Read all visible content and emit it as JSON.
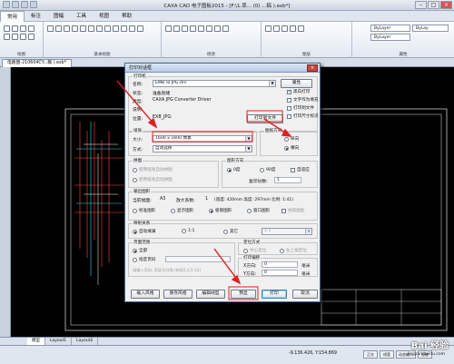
{
  "app": {
    "title": "CAXA CAD 电子图板2015 - [F:\\1.草...                        (0) ...稿 ).exb*]"
  },
  "menu": {
    "tabs": [
      "常用",
      "标注",
      "图幅",
      "工具",
      "视图",
      "帮助"
    ],
    "active": 0
  },
  "ribbon": {
    "groups": [
      "绘图",
      "修改",
      "标注",
      "基本绘图",
      "图层",
      "属性"
    ],
    "by_layer_1": "ByLayer",
    "by_layer_2": "ByLayer",
    "by_layer_3": "ByLay"
  },
  "document_tab": "电路图-210604CY...稿 ).exb*",
  "layout_tabs": [
    "模型",
    "Layout1",
    "Layout2"
  ],
  "status": {
    "coords": "-9.136.426, Y:154.869",
    "buttons": [
      "正交",
      "线宽",
      "动态输入",
      "智能"
    ]
  },
  "dialog": {
    "title": "打印对话框",
    "printer_group": "打印机",
    "name_label": "名称:",
    "name_value": "EMB To JPG.drv",
    "properties_button": "属性",
    "status_label": "状态:",
    "status_value": "准备就绪",
    "type_label": "类型:",
    "type_value": "CAXA JPG Converter Driver",
    "desc_label": "说明:",
    "location_label": "位置:",
    "location_value": "EXB_JPG:",
    "print_to_file_button": "打印到文件",
    "black_print": "黑白打印",
    "text_as_box": "文字作为填充",
    "print_to_file": "打印到文件",
    "print_size": "打印尺寸标识",
    "paper_group": "纸张",
    "size_label": "大小:",
    "size_value": "1600 x 1600 像素",
    "source_label": "方式:",
    "source_value": "自动选择",
    "orientation_group": "图纸方向",
    "portrait": "纵向",
    "landscape": "横向",
    "fit_group": "拼图",
    "fit_opt1": "使用纸张自动拼图",
    "fit_opt2": "使用纸张自动拼图",
    "rotate_group": "图形方向",
    "rot_0": "0度",
    "rot_90": "90度",
    "auto_fit": "自适应",
    "copies_label": "复印份数:",
    "copies_value": "1",
    "output_group": "输出图形",
    "frame_label": "当前幅面:",
    "frame_value": "A3",
    "scale_label": "放大系数:",
    "scale_value": "1",
    "dims": "(宽度: 420mm  高度: 297mm  比例: 1:41)",
    "out_standard": "标准图形",
    "out_display": "显示图形",
    "out_extents": "极限图形",
    "out_window": "窗口图形",
    "out_frame_fit": "拾取图框",
    "map_group": "映射关系",
    "map_auto": "自动填满",
    "map_11": "1:1",
    "map_other": "其它",
    "map_ratio": "1:1",
    "page_group": "页面范围",
    "page_all": "全部",
    "page_frames": "指定页码",
    "page_hint": "请输入页码, 用逗号分隔 (例如1,3,5-12)",
    "pos_group": "定位方式",
    "pos_center": "中心定位",
    "pos_leftbottom": "左上角定位",
    "offset_group": "打印偏移",
    "x_label": "X方向:",
    "x_value": "0",
    "y_label": "Y方向:",
    "y_value": "0",
    "mm": "毫米",
    "buttons": {
      "load": "载入风格",
      "save": "保存风格",
      "edit_lines": "编辑线型",
      "preview": "预显",
      "print": "打印",
      "cancel": "取消"
    }
  },
  "watermark": {
    "text": "Bai 经验",
    "url": "jingyan.baidu.com"
  }
}
